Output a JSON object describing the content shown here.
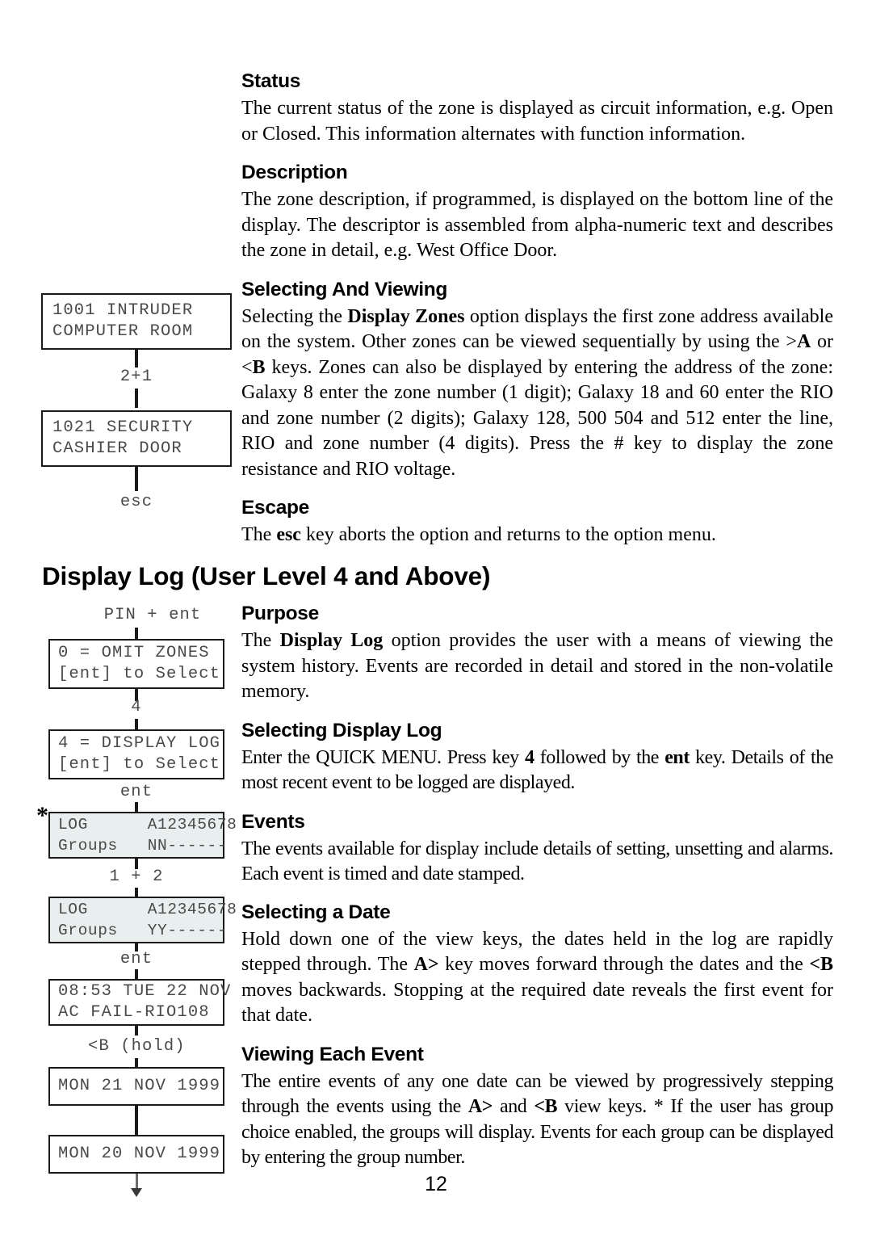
{
  "page": {
    "number": "12"
  },
  "sections": [
    {
      "heading": "Status",
      "body": "The current status of the zone is displayed as circuit information, e.g. Open or Closed. This information alternates with function information."
    },
    {
      "heading": "Description",
      "body": "The zone description, if programmed, is displayed on the bottom line of the display. The descriptor is assembled from alpha-numeric text and describes the zone in detail, e.g. West Office Door."
    },
    {
      "heading": "Selecting And Viewing",
      "body_part1": "Selecting the ",
      "body_bold1": "Display Zones",
      "body_part2": " option displays the first zone address available on the system. Other zones can be viewed sequentially by using the >",
      "body_bold2": "A",
      "body_part3": " or <",
      "body_bold3": "B",
      "body_part4": " keys. Zones can also be displayed by entering the address of the zone: Galaxy 8 enter the zone number (1 digit); Galaxy 18 and 60 enter the RIO and zone number (2 digits); Galaxy 128, 500 504 and 512 enter the line, RIO and zone number (4 digits). Press the # key to display the zone resistance and RIO voltage."
    },
    {
      "heading": "Escape",
      "body_part1": "The ",
      "body_bold1": "esc",
      "body_part2": " key aborts the option and returns to the option menu."
    },
    {
      "heading": "Purpose",
      "body_part1": "The ",
      "body_bold1": "Display Log",
      "body_part2": " option provides the user with a means of viewing the system history. Events are recorded in detail and stored in the  non-volatile memory."
    },
    {
      "heading": "Selecting Display Log",
      "body_part1": "Enter the QUICK MENU. Press key ",
      "body_bold1": "4",
      "body_part2": " followed by the ",
      "body_bold2": "ent",
      "body_part3": " key.  Details of the most recent event to be logged are displayed."
    },
    {
      "heading": "Events",
      "body": "The events available for display include details of setting, unsetting and alarms. Each event is timed and date stamped."
    },
    {
      "heading": "Selecting a Date",
      "body_part1": "Hold down one of the view keys, the dates held in the log are rapidly stepped through. The ",
      "body_bold1": "A>",
      "body_part2": " key moves forward through the dates and the ",
      "body_bold2": "<B",
      "body_part3": " moves backwards. Stopping at the required date reveals the first event for that date."
    },
    {
      "heading": "Viewing Each Event",
      "body_part1": "The entire events of any one date can be viewed by progressively stepping through the events using the ",
      "body_bold1": "A>",
      "body_part2": " and ",
      "body_bold2": "<B",
      "body_part3": " view keys.  *  If the user has group choice enabled, the groups will display. Events for each group can be displayed by entering the group number."
    }
  ],
  "chapter_heading": "Display Log  (User Level 4 and Above)",
  "diagram_zones": {
    "box1_line1": "1001 INTRUDER",
    "box1_line2": "COMPUTER ROOM",
    "connector1": "2+1",
    "box2_line1": "1021 SECURITY",
    "box2_line2": "CASHIER DOOR",
    "connector2": "esc"
  },
  "diagram_log": {
    "top_label": "PIN + ent",
    "box1_line1": "0 = OMIT ZONES",
    "box1_line2": "[ent] to Select",
    "connector1": "4",
    "box2_line1": "4 = DISPLAY LOG",
    "box2_line2": "[ent] to Select",
    "connector2": "ent",
    "star_marker": "*",
    "box3_line1": "LOG      A12345678",
    "box3_line2": "Groups   NN------",
    "connector3": "1 + 2",
    "box4_line1": "LOG      A12345678",
    "box4_line2": "Groups   YY------",
    "connector4": "ent",
    "box5_line1": "08:53 TUE 22 NOV",
    "box5_line2": "AC FAIL-RIO108",
    "connector5": "<B (hold)",
    "box6_line1": "MON 21 NOV 1999",
    "box7_line1": "MON 20 NOV 1999"
  }
}
